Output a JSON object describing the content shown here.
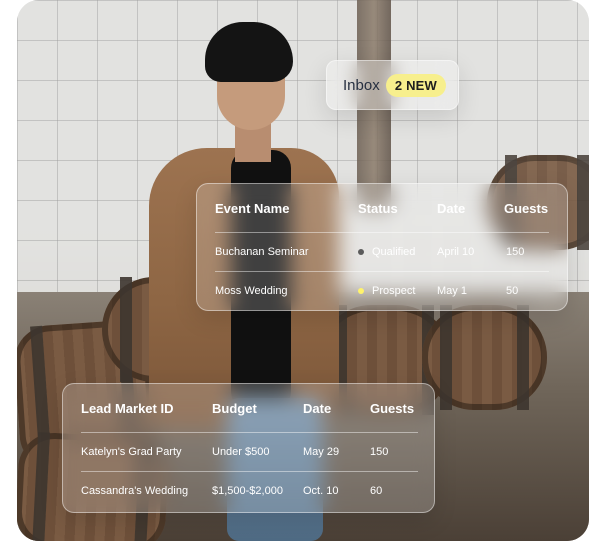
{
  "inbox": {
    "label": "Inbox",
    "badge": "2 NEW"
  },
  "events_table": {
    "headers": [
      "Event Name",
      "Status",
      "Date",
      "Guests"
    ],
    "rows": [
      {
        "event_name": "Buchanan Seminar",
        "status": "Qualified",
        "date": "April 10",
        "guests": "150"
      },
      {
        "event_name": "Moss Wedding",
        "status": "Prospect",
        "date": "May 1",
        "guests": "50"
      }
    ]
  },
  "leads_table": {
    "headers": [
      "Lead Market ID",
      "Budget",
      "Date",
      "Guests"
    ],
    "rows": [
      {
        "lead_market_id": "Katelyn's Grad Party",
        "budget": "Under $500",
        "date": "May 29",
        "guests": "150"
      },
      {
        "lead_market_id": "Cassandra's Wedding",
        "budget": "$1,500-$2,000",
        "date": "Oct. 10",
        "guests": "60"
      }
    ]
  },
  "colors": {
    "badge_bg": "#f7ef8d",
    "qualified_dot": "#5b5b5b",
    "prospect_dot": "#fff36b",
    "card_text": "#ffffff",
    "inbox_text": "#273041"
  },
  "icons": {
    "status_dot": "dot-icon"
  }
}
